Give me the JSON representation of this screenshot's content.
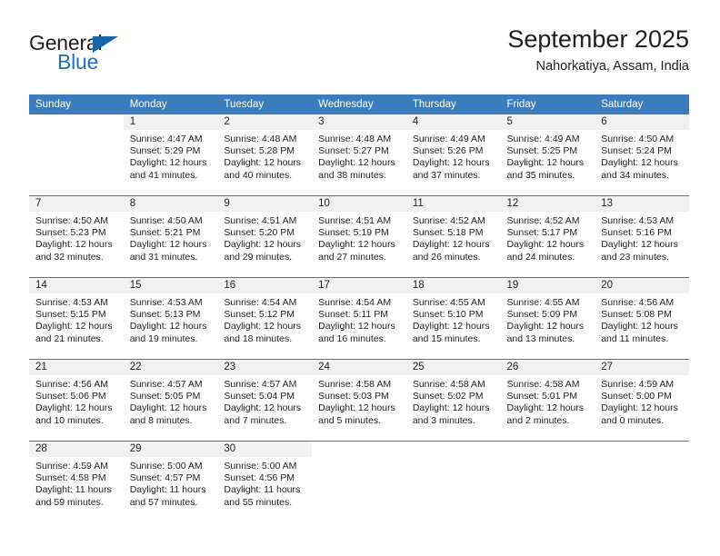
{
  "brand": {
    "name_top": "General",
    "name_bottom": "Blue",
    "accent_color": "#1566ad",
    "text_color": "#231f20"
  },
  "header": {
    "title": "September 2025",
    "subtitle": "Nahorkatiya, Assam, India"
  },
  "calendar": {
    "header_bg": "#3b7cbd",
    "daynum_bg": "#f1f1f1",
    "weekday_labels": [
      "Sunday",
      "Monday",
      "Tuesday",
      "Wednesday",
      "Thursday",
      "Friday",
      "Saturday"
    ],
    "weeks": [
      [
        {
          "day": "",
          "lines": []
        },
        {
          "day": "1",
          "lines": [
            "Sunrise: 4:47 AM",
            "Sunset: 5:29 PM",
            "Daylight: 12 hours",
            "and 41 minutes."
          ]
        },
        {
          "day": "2",
          "lines": [
            "Sunrise: 4:48 AM",
            "Sunset: 5:28 PM",
            "Daylight: 12 hours",
            "and 40 minutes."
          ]
        },
        {
          "day": "3",
          "lines": [
            "Sunrise: 4:48 AM",
            "Sunset: 5:27 PM",
            "Daylight: 12 hours",
            "and 38 minutes."
          ]
        },
        {
          "day": "4",
          "lines": [
            "Sunrise: 4:49 AM",
            "Sunset: 5:26 PM",
            "Daylight: 12 hours",
            "and 37 minutes."
          ]
        },
        {
          "day": "5",
          "lines": [
            "Sunrise: 4:49 AM",
            "Sunset: 5:25 PM",
            "Daylight: 12 hours",
            "and 35 minutes."
          ]
        },
        {
          "day": "6",
          "lines": [
            "Sunrise: 4:50 AM",
            "Sunset: 5:24 PM",
            "Daylight: 12 hours",
            "and 34 minutes."
          ]
        }
      ],
      [
        {
          "day": "7",
          "lines": [
            "Sunrise: 4:50 AM",
            "Sunset: 5:23 PM",
            "Daylight: 12 hours",
            "and 32 minutes."
          ]
        },
        {
          "day": "8",
          "lines": [
            "Sunrise: 4:50 AM",
            "Sunset: 5:21 PM",
            "Daylight: 12 hours",
            "and 31 minutes."
          ]
        },
        {
          "day": "9",
          "lines": [
            "Sunrise: 4:51 AM",
            "Sunset: 5:20 PM",
            "Daylight: 12 hours",
            "and 29 minutes."
          ]
        },
        {
          "day": "10",
          "lines": [
            "Sunrise: 4:51 AM",
            "Sunset: 5:19 PM",
            "Daylight: 12 hours",
            "and 27 minutes."
          ]
        },
        {
          "day": "11",
          "lines": [
            "Sunrise: 4:52 AM",
            "Sunset: 5:18 PM",
            "Daylight: 12 hours",
            "and 26 minutes."
          ]
        },
        {
          "day": "12",
          "lines": [
            "Sunrise: 4:52 AM",
            "Sunset: 5:17 PM",
            "Daylight: 12 hours",
            "and 24 minutes."
          ]
        },
        {
          "day": "13",
          "lines": [
            "Sunrise: 4:53 AM",
            "Sunset: 5:16 PM",
            "Daylight: 12 hours",
            "and 23 minutes."
          ]
        }
      ],
      [
        {
          "day": "14",
          "lines": [
            "Sunrise: 4:53 AM",
            "Sunset: 5:15 PM",
            "Daylight: 12 hours",
            "and 21 minutes."
          ]
        },
        {
          "day": "15",
          "lines": [
            "Sunrise: 4:53 AM",
            "Sunset: 5:13 PM",
            "Daylight: 12 hours",
            "and 19 minutes."
          ]
        },
        {
          "day": "16",
          "lines": [
            "Sunrise: 4:54 AM",
            "Sunset: 5:12 PM",
            "Daylight: 12 hours",
            "and 18 minutes."
          ]
        },
        {
          "day": "17",
          "lines": [
            "Sunrise: 4:54 AM",
            "Sunset: 5:11 PM",
            "Daylight: 12 hours",
            "and 16 minutes."
          ]
        },
        {
          "day": "18",
          "lines": [
            "Sunrise: 4:55 AM",
            "Sunset: 5:10 PM",
            "Daylight: 12 hours",
            "and 15 minutes."
          ]
        },
        {
          "day": "19",
          "lines": [
            "Sunrise: 4:55 AM",
            "Sunset: 5:09 PM",
            "Daylight: 12 hours",
            "and 13 minutes."
          ]
        },
        {
          "day": "20",
          "lines": [
            "Sunrise: 4:56 AM",
            "Sunset: 5:08 PM",
            "Daylight: 12 hours",
            "and 11 minutes."
          ]
        }
      ],
      [
        {
          "day": "21",
          "lines": [
            "Sunrise: 4:56 AM",
            "Sunset: 5:06 PM",
            "Daylight: 12 hours",
            "and 10 minutes."
          ]
        },
        {
          "day": "22",
          "lines": [
            "Sunrise: 4:57 AM",
            "Sunset: 5:05 PM",
            "Daylight: 12 hours",
            "and 8 minutes."
          ]
        },
        {
          "day": "23",
          "lines": [
            "Sunrise: 4:57 AM",
            "Sunset: 5:04 PM",
            "Daylight: 12 hours",
            "and 7 minutes."
          ]
        },
        {
          "day": "24",
          "lines": [
            "Sunrise: 4:58 AM",
            "Sunset: 5:03 PM",
            "Daylight: 12 hours",
            "and 5 minutes."
          ]
        },
        {
          "day": "25",
          "lines": [
            "Sunrise: 4:58 AM",
            "Sunset: 5:02 PM",
            "Daylight: 12 hours",
            "and 3 minutes."
          ]
        },
        {
          "day": "26",
          "lines": [
            "Sunrise: 4:58 AM",
            "Sunset: 5:01 PM",
            "Daylight: 12 hours",
            "and 2 minutes."
          ]
        },
        {
          "day": "27",
          "lines": [
            "Sunrise: 4:59 AM",
            "Sunset: 5:00 PM",
            "Daylight: 12 hours",
            "and 0 minutes."
          ]
        }
      ],
      [
        {
          "day": "28",
          "lines": [
            "Sunrise: 4:59 AM",
            "Sunset: 4:58 PM",
            "Daylight: 11 hours",
            "and 59 minutes."
          ]
        },
        {
          "day": "29",
          "lines": [
            "Sunrise: 5:00 AM",
            "Sunset: 4:57 PM",
            "Daylight: 11 hours",
            "and 57 minutes."
          ]
        },
        {
          "day": "30",
          "lines": [
            "Sunrise: 5:00 AM",
            "Sunset: 4:56 PM",
            "Daylight: 11 hours",
            "and 55 minutes."
          ]
        },
        {
          "day": "",
          "lines": []
        },
        {
          "day": "",
          "lines": []
        },
        {
          "day": "",
          "lines": []
        },
        {
          "day": "",
          "lines": []
        }
      ]
    ]
  }
}
